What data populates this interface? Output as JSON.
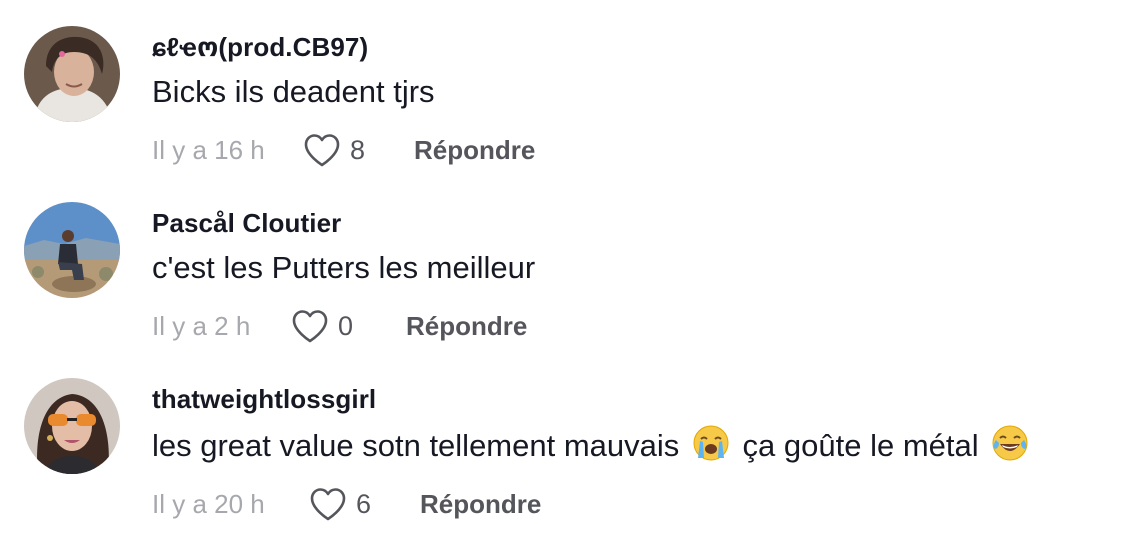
{
  "comments": [
    {
      "username": "ɕℓҽო(prod.CB97)",
      "text": "Bicks ils deadent tjrs",
      "time": "Il y a 16 h",
      "likes": "8",
      "reply_label": "Répondre"
    },
    {
      "username": "Pascål Cloutier",
      "text": "c'est les Putters les meilleur",
      "time": "Il y a 2 h",
      "likes": "0",
      "reply_label": "Répondre"
    },
    {
      "username": "thatweightlossgirl",
      "text_part1": "les great value sotn tellement mauvais",
      "text_part2": "ça goûte le métal",
      "emoji1": "loudly-crying-face-emoji",
      "emoji2": "tears-of-joy-emoji",
      "time": "Il y a 20 h",
      "likes": "6",
      "reply_label": "Répondre"
    }
  ],
  "icons": {
    "like": "heart-outline-icon"
  },
  "colors": {
    "text": "#161823",
    "muted": "#a7a8ad",
    "secondary": "#54565c"
  }
}
